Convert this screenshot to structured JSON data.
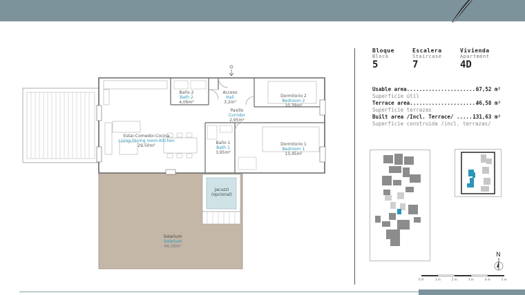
{
  "info": {
    "bloque": {
      "label_es": "Bloque",
      "label_en": "Block",
      "value": "5"
    },
    "escalera": {
      "label_es": "Escalera",
      "label_en": "Staircase",
      "value": "7"
    },
    "vivienda": {
      "label_es": "Vivienda",
      "label_en": "Apartment",
      "value": "4D"
    }
  },
  "areas": {
    "usable_label": "Usable area.......................",
    "usable_value": "67,52 m²",
    "usable_sub": "Superficie útil",
    "terrace_label": "Terrace area......................",
    "terrace_value": "46,58 m²",
    "terrace_sub": "Superficie terrazas",
    "built_label": "Built area /Incl. Terrace/ ......",
    "built_value": "131,63 m²",
    "built_sub": "Superficie construida /incl. terrazas/"
  },
  "rooms": {
    "bath2": {
      "es": "Baño 2",
      "en": "Bath 2",
      "area": "4,06m²"
    },
    "hall": {
      "es": "Acceso",
      "en": "Hall",
      "area": "3,2m²"
    },
    "bedroom2": {
      "es": "Dormitorio 2",
      "en": "Bedroom 2",
      "area": "10,39m²"
    },
    "corridor": {
      "es": "Pasillo",
      "en": "Corridor",
      "area": "2,95m²"
    },
    "living": {
      "es": "Estar-Comedor-Cocina",
      "en": "Living-Dining room-Kitchen",
      "area": "29,50m²"
    },
    "bath1": {
      "es": "Baño 1",
      "en": "Bath 1",
      "area": "3,95m²"
    },
    "bedroom1": {
      "es": "Dormitorio 1",
      "en": "Bedroom 1",
      "area": "13,45m²"
    },
    "jacuzzi": {
      "line1": "Jacuzzi",
      "line2": "(opcional)"
    },
    "solarium": {
      "es": "Solarium",
      "en": "Solarium",
      "area": "46,58m²"
    }
  },
  "compass": {
    "label": "N"
  },
  "scale": {
    "labels": [
      "0 m",
      "1 m",
      "2 m",
      "3 m",
      "4 m",
      "5 m"
    ]
  },
  "colors": {
    "header": "#7d939c",
    "accent": "#2a96b8",
    "solarium": "#c4b7a7",
    "jacuzzi": "#cfe3e6"
  }
}
